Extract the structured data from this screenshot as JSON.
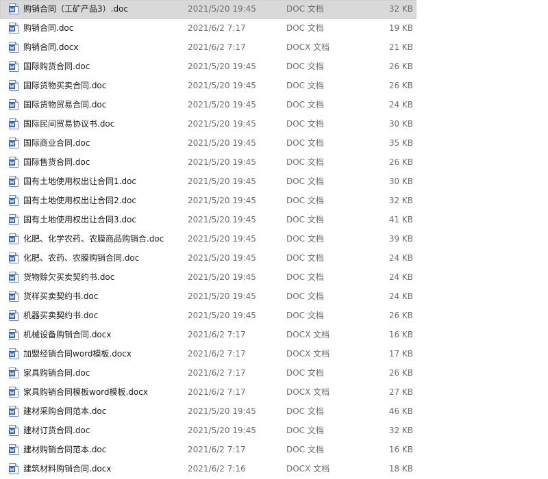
{
  "colors": {
    "selected_row_bg": "#d9d9d9",
    "icon_blue": "#2b63c6",
    "meta_text": "#6d6d6d"
  },
  "files": [
    {
      "name": "购销合同（工矿产品3）.doc",
      "date": "2021/5/20 19:45",
      "type": "DOC 文档",
      "size": "32 KB",
      "icon": "word-doc-icon",
      "selected": true
    },
    {
      "name": "购销合同.doc",
      "date": "2021/6/2 7:17",
      "type": "DOC 文档",
      "size": "19 KB",
      "icon": "word-doc-icon"
    },
    {
      "name": "购销合同.docx",
      "date": "2021/6/2 7:17",
      "type": "DOCX 文档",
      "size": "21 KB",
      "icon": "word-docx-icon"
    },
    {
      "name": "国际购货合同.doc",
      "date": "2021/5/20 19:45",
      "type": "DOC 文档",
      "size": "26 KB",
      "icon": "word-doc-icon"
    },
    {
      "name": "国际货物买卖合同.doc",
      "date": "2021/5/20 19:45",
      "type": "DOC 文档",
      "size": "26 KB",
      "icon": "word-doc-icon"
    },
    {
      "name": "国际货物贸易合同.doc",
      "date": "2021/5/20 19:45",
      "type": "DOC 文档",
      "size": "24 KB",
      "icon": "word-doc-icon"
    },
    {
      "name": "国际民间贸易协议书.doc",
      "date": "2021/5/20 19:45",
      "type": "DOC 文档",
      "size": "30 KB",
      "icon": "word-doc-icon"
    },
    {
      "name": "国际商业合同.doc",
      "date": "2021/5/20 19:45",
      "type": "DOC 文档",
      "size": "35 KB",
      "icon": "word-doc-icon"
    },
    {
      "name": "国际售货合同.doc",
      "date": "2021/5/20 19:45",
      "type": "DOC 文档",
      "size": "26 KB",
      "icon": "word-doc-icon"
    },
    {
      "name": "国有土地使用权出让合同1.doc",
      "date": "2021/5/20 19:45",
      "type": "DOC 文档",
      "size": "30 KB",
      "icon": "word-doc-icon"
    },
    {
      "name": "国有土地使用权出让合同2.doc",
      "date": "2021/5/20 19:45",
      "type": "DOC 文档",
      "size": "32 KB",
      "icon": "word-doc-icon"
    },
    {
      "name": "国有土地使用权出让合同3.doc",
      "date": "2021/5/20 19:45",
      "type": "DOC 文档",
      "size": "41 KB",
      "icon": "word-doc-icon"
    },
    {
      "name": "化肥、化学农药、农膜商品购销合.doc",
      "date": "2021/5/20 19:45",
      "type": "DOC 文档",
      "size": "39 KB",
      "icon": "word-doc-icon"
    },
    {
      "name": "化肥、农药、农膜购销合同.doc",
      "date": "2021/5/20 19:45",
      "type": "DOC 文档",
      "size": "24 KB",
      "icon": "word-doc-icon"
    },
    {
      "name": "货物赊欠买卖契约书.doc",
      "date": "2021/5/20 19:45",
      "type": "DOC 文档",
      "size": "24 KB",
      "icon": "word-doc-icon"
    },
    {
      "name": "货样买卖契约书.doc",
      "date": "2021/5/20 19:45",
      "type": "DOC 文档",
      "size": "24 KB",
      "icon": "word-doc-icon"
    },
    {
      "name": "机器买卖契约书.doc",
      "date": "2021/5/20 19:45",
      "type": "DOC 文档",
      "size": "26 KB",
      "icon": "word-doc-icon"
    },
    {
      "name": "机械设备购销合同.docx",
      "date": "2021/6/2 7:17",
      "type": "DOCX 文档",
      "size": "16 KB",
      "icon": "word-docx-icon"
    },
    {
      "name": "加盟经销合同word模板.docx",
      "date": "2021/6/2 7:17",
      "type": "DOCX 文档",
      "size": "17 KB",
      "icon": "word-docx-icon"
    },
    {
      "name": "家具购销合同.doc",
      "date": "2021/6/2 7:17",
      "type": "DOC 文档",
      "size": "26 KB",
      "icon": "word-doc-icon"
    },
    {
      "name": "家具购销合同模板word模板.docx",
      "date": "2021/6/2 7:17",
      "type": "DOCX 文档",
      "size": "27 KB",
      "icon": "word-docx-icon"
    },
    {
      "name": "建材采购合同范本.doc",
      "date": "2021/5/20 19:45",
      "type": "DOC 文档",
      "size": "46 KB",
      "icon": "word-doc-icon"
    },
    {
      "name": "建材订货合同.doc",
      "date": "2021/5/20 19:45",
      "type": "DOC 文档",
      "size": "32 KB",
      "icon": "word-doc-icon"
    },
    {
      "name": "建材购销合同范本.doc",
      "date": "2021/6/2 7:17",
      "type": "DOC 文档",
      "size": "16 KB",
      "icon": "word-doc-icon"
    },
    {
      "name": "建筑材料购销合同.docx",
      "date": "2021/6/2 7:16",
      "type": "DOCX 文档",
      "size": "18 KB",
      "icon": "word-docx-icon"
    }
  ]
}
